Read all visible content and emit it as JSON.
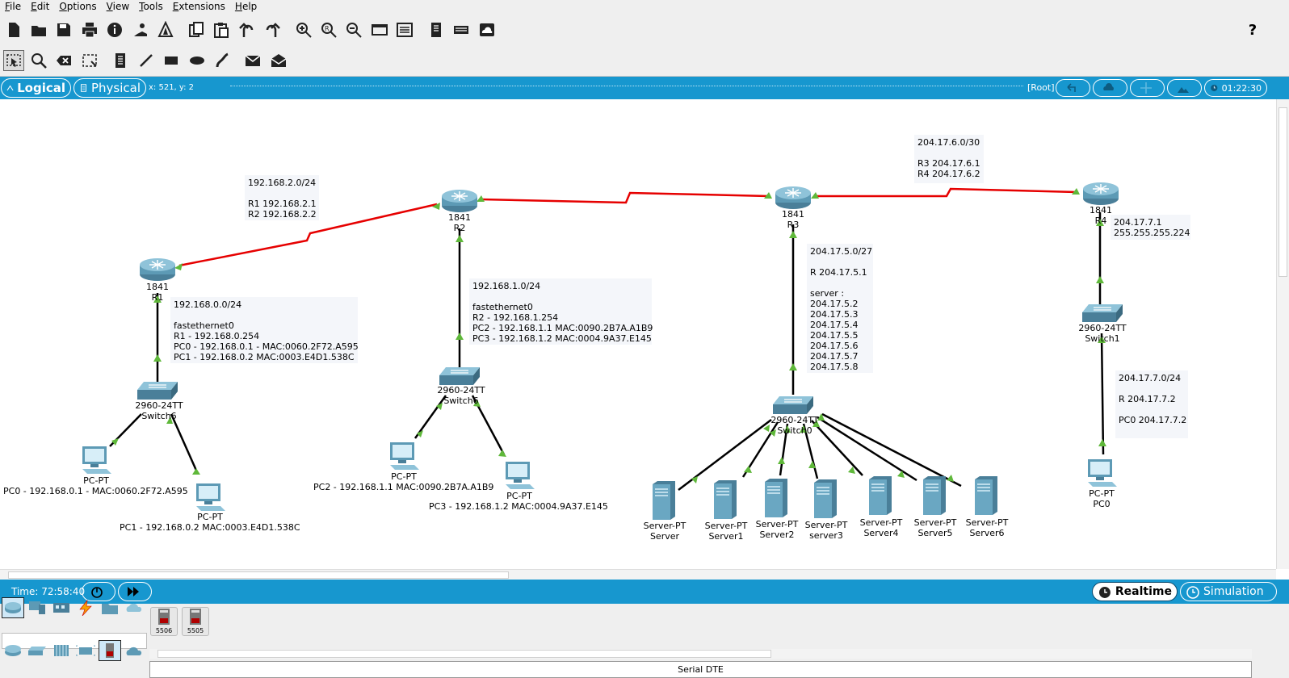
{
  "menu": [
    "File",
    "Edit",
    "Options",
    "View",
    "Tools",
    "Extensions",
    "Help"
  ],
  "toolbar_main_icons": [
    "new-file-icon",
    "open-folder-icon",
    "save-icon",
    "print-icon",
    "info-icon",
    "activity-wizard-icon",
    "network-info-icon",
    "copy-icon",
    "paste-icon",
    "undo-icon",
    "redo-icon",
    "zoom-in-icon",
    "zoom-reset-icon",
    "zoom-out-icon",
    "drawing-palette-icon",
    "custom-devices-icon",
    "text-file-icon",
    "pdu-list-icon",
    "cloud-icon"
  ],
  "toolbar_help": "?",
  "toolbar_tools_icons": [
    "select-icon",
    "inspect-icon",
    "delete-icon",
    "resize-icon",
    "note-icon",
    "line-icon",
    "rectangle-icon",
    "ellipse-icon",
    "freeform-icon",
    "simple-pdu-icon",
    "complex-pdu-icon"
  ],
  "workspace": {
    "logical_label": "Logical",
    "physical_label": "Physical",
    "coords": "x: 521, y: 2",
    "root_label": "[Root]",
    "clock": "01:22:30"
  },
  "notes": {
    "r1r2": "192.168.2.0/24\n\nR1 192.168.2.1\nR2 192.168.2.2",
    "r3r4": "204.17.6.0/30\n\nR3 204.17.6.1\nR4 204.17.6.2",
    "lan0": "192.168.0.0/24\n\nfastethernet0\nR1 - 192.168.0.254\nPC0 - 192.168.0.1 - MAC:0060.2F72.A595\nPC1 - 192.168.0.2 MAC:0003.E4D1.538C",
    "lan1": "192.168.1.0/24\n\nfastethernet0\nR2 - 192.168.1.254\nPC2 - 192.168.1.1 MAC:0090.2B7A.A1B9\nPC3 - 192.168.1.2 MAC:0004.9A37.E145",
    "lan5": "204.17.5.0/27\n\nR 204.17.5.1\n\nserver :\n204.17.5.2\n204.17.5.3\n204.17.5.4\n204.17.5.5\n204.17.5.6\n204.17.5.7\n204.17.5.8",
    "r4lan": "204.17.7.1\n255.255.255.224",
    "lan7": "204.17.7.0/24\n\nR 204.17.7.2\n\nPC0 204.17.7.2"
  },
  "devices": {
    "r1": {
      "model": "1841",
      "name": "R1"
    },
    "r2": {
      "model": "1841",
      "name": "R2"
    },
    "r3": {
      "model": "1841",
      "name": "R3"
    },
    "r4": {
      "model": "1841",
      "name": "R4"
    },
    "sw_a": {
      "model": "2960-24TT",
      "name": "Switch6"
    },
    "sw_b": {
      "model": "2960-24TT",
      "name": "Switch6"
    },
    "sw_c": {
      "model": "2960-24TT",
      "name": "Switch0"
    },
    "sw_d": {
      "model": "2960-24TT",
      "name": "Switch1"
    },
    "pc0": {
      "type": "PC-PT",
      "name": "PC0 - 192.168.0.1 - MAC:0060.2F72.A595"
    },
    "pc1": {
      "type": "PC-PT",
      "name": "PC1 - 192.168.0.2 MAC:0003.E4D1.538C"
    },
    "pc2": {
      "type": "PC-PT",
      "name": "PC2 - 192.168.1.1 MAC:0090.2B7A.A1B9"
    },
    "pc3": {
      "type": "PC-PT",
      "name": "PC3 - 192.168.1.2 MAC:0004.9A37.E145"
    },
    "pc4": {
      "type": "PC-PT",
      "name": "PC0"
    },
    "srv0": {
      "type": "Server-PT",
      "name": "Server"
    },
    "srv1": {
      "type": "Server-PT",
      "name": "Server1"
    },
    "srv2": {
      "type": "Server-PT",
      "name": "Server2"
    },
    "srv3": {
      "type": "Server-PT",
      "name": "server3"
    },
    "srv4": {
      "type": "Server-PT",
      "name": "Server4"
    },
    "srv5": {
      "type": "Server-PT",
      "name": "Server5"
    },
    "srv6": {
      "type": "Server-PT",
      "name": "Server6"
    }
  },
  "simulation": {
    "time": "Time: 72:58:40",
    "realtime_label": "Realtime",
    "simulation_label": "Simulation"
  },
  "device_panel": {
    "cards": [
      "5506",
      "5505"
    ],
    "connection_label": "Serial DTE",
    "search_value": ""
  },
  "colors": {
    "blue_bar": "#1797cf",
    "serial_link": "#e60000",
    "ethernet_link": "#000000",
    "link_up": "#5fb83a"
  }
}
